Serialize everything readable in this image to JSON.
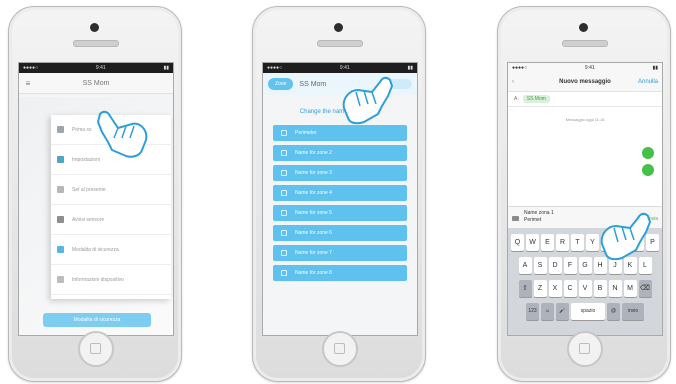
{
  "phone1": {
    "nav_back": "≡",
    "nav_title": "SS Mom",
    "menu_items": [
      {
        "label": "Prima ss",
        "color": "#9aa6b0"
      },
      {
        "label": "Impostazioni",
        "color": "#4fa3c7"
      },
      {
        "label": "Set al presente",
        "color": "#b8b8b8"
      },
      {
        "label": "Avvisi sensore",
        "color": "#8e8e8e"
      },
      {
        "label": "Modalita di sicurezza",
        "color": "#58b6e0"
      },
      {
        "label": "Informazioni dispositivo",
        "color": "#bdbdbd"
      }
    ],
    "bottom_button": "Modalita di sicurezza"
  },
  "phone2": {
    "tab_label": "Zone",
    "title": "SS Mom",
    "heading": "Change the name of any zone",
    "zones": [
      "Perimeter",
      "Name for zone 2",
      "Name for zone 3",
      "Name for zone 4",
      "Name for zone 5",
      "Name for zone 6",
      "Name for zone 7",
      "Name for zone 8"
    ]
  },
  "phone3": {
    "nav_left": "‹",
    "nav_title": "Nuovo messaggio",
    "nav_right": "Annulla",
    "to_label": "A:",
    "to_recipient": "SS Mom",
    "timestamp": "Messaggio oggi 11:16",
    "compose_line1": "Name zona 1",
    "compose_line2": "Perimet",
    "send_label": "Invia",
    "keyboard_rows": [
      [
        "Q",
        "W",
        "E",
        "R",
        "T",
        "Y",
        "U",
        "I",
        "O",
        "P"
      ],
      [
        "A",
        "S",
        "D",
        "F",
        "G",
        "H",
        "J",
        "K",
        "L"
      ],
      [
        "Z",
        "X",
        "C",
        "V",
        "B",
        "N",
        "M"
      ]
    ],
    "bottom_row": [
      "123",
      "☺",
      "🎤",
      "spazio",
      "@",
      "invio"
    ]
  },
  "status_time": "9:41",
  "accent_blue": "#5ec1ee",
  "accent_green": "#45c04a"
}
